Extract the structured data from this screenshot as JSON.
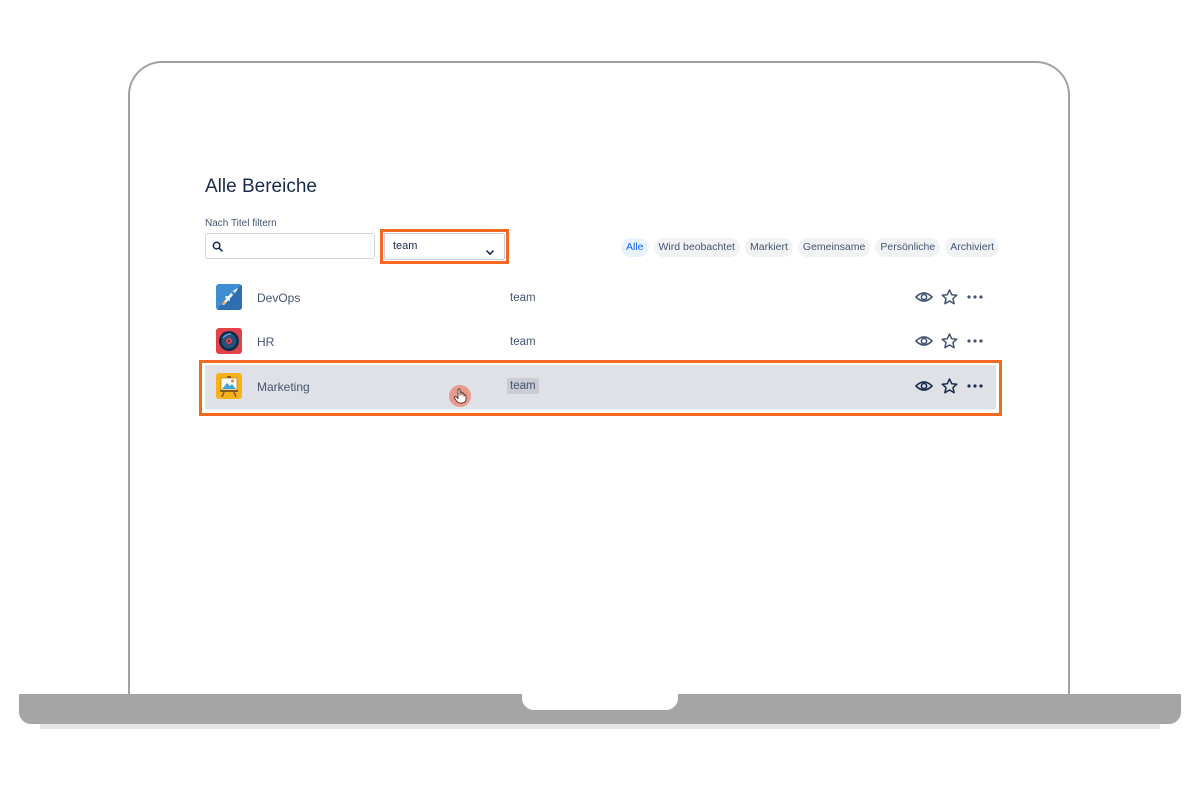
{
  "page": {
    "title": "Alle Bereiche"
  },
  "filter": {
    "label": "Nach Titel filtern",
    "search_value": "",
    "search_placeholder": "",
    "type_select_value": "team"
  },
  "tabs": [
    {
      "label": "Alle",
      "active": true
    },
    {
      "label": "Wird beobachtet",
      "active": false
    },
    {
      "label": "Markiert",
      "active": false
    },
    {
      "label": "Gemeinsame",
      "active": false
    },
    {
      "label": "Persönliche",
      "active": false
    },
    {
      "label": "Archiviert",
      "active": false
    }
  ],
  "spaces": [
    {
      "name": "DevOps",
      "type": "team",
      "icon": "rocket-icon"
    },
    {
      "name": "HR",
      "type": "team",
      "icon": "record-icon"
    },
    {
      "name": "Marketing",
      "type": "team",
      "icon": "easel-icon",
      "hovered": true
    }
  ],
  "icons": {
    "search": "search-icon",
    "dropdown": "chevron-down-icon",
    "watch": "eye-icon",
    "star": "star-icon",
    "more": "more-icon",
    "cursor": "hand-cursor-icon"
  },
  "colors": {
    "highlight": "#f26a21",
    "active_tab": "#0c66e4",
    "hover_row": "#dfe1e6"
  }
}
